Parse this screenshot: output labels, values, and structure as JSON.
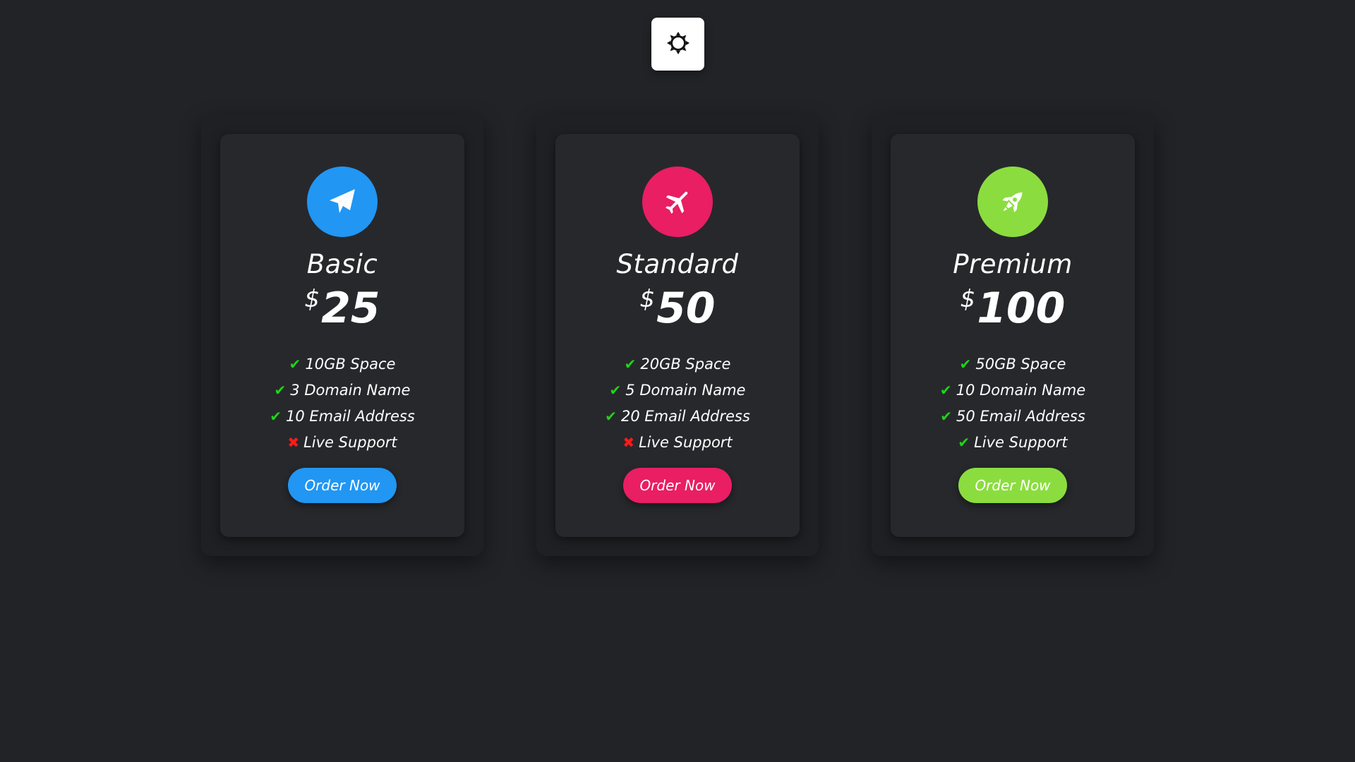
{
  "theme_toggle": {
    "icon": "sun-icon"
  },
  "plans": [
    {
      "name": "Basic",
      "currency": "$",
      "price": "25",
      "icon": "paper-plane-icon",
      "color": "#2196f3",
      "features": [
        {
          "text": "10GB Space",
          "included": true
        },
        {
          "text": "3 Domain Name",
          "included": true
        },
        {
          "text": "10 Email Address",
          "included": true
        },
        {
          "text": "Live Support",
          "included": false
        }
      ],
      "button_label": "Order Now"
    },
    {
      "name": "Standard",
      "currency": "$",
      "price": "50",
      "icon": "airplane-icon",
      "color": "#e91e63",
      "features": [
        {
          "text": "20GB Space",
          "included": true
        },
        {
          "text": "5 Domain Name",
          "included": true
        },
        {
          "text": "20 Email Address",
          "included": true
        },
        {
          "text": "Live Support",
          "included": false
        }
      ],
      "button_label": "Order Now"
    },
    {
      "name": "Premium",
      "currency": "$",
      "price": "100",
      "icon": "rocket-icon",
      "color": "#8bdd3f",
      "features": [
        {
          "text": "50GB Space",
          "included": true
        },
        {
          "text": "10 Domain Name",
          "included": true
        },
        {
          "text": "50 Email Address",
          "included": true
        },
        {
          "text": "Live Support",
          "included": true
        }
      ],
      "button_label": "Order Now"
    }
  ],
  "colors": {
    "background": "#222327",
    "card_outer": "#1f2023",
    "card_inner": "#27282c",
    "check": "#1fd419",
    "cross": "#ff1a1a"
  }
}
